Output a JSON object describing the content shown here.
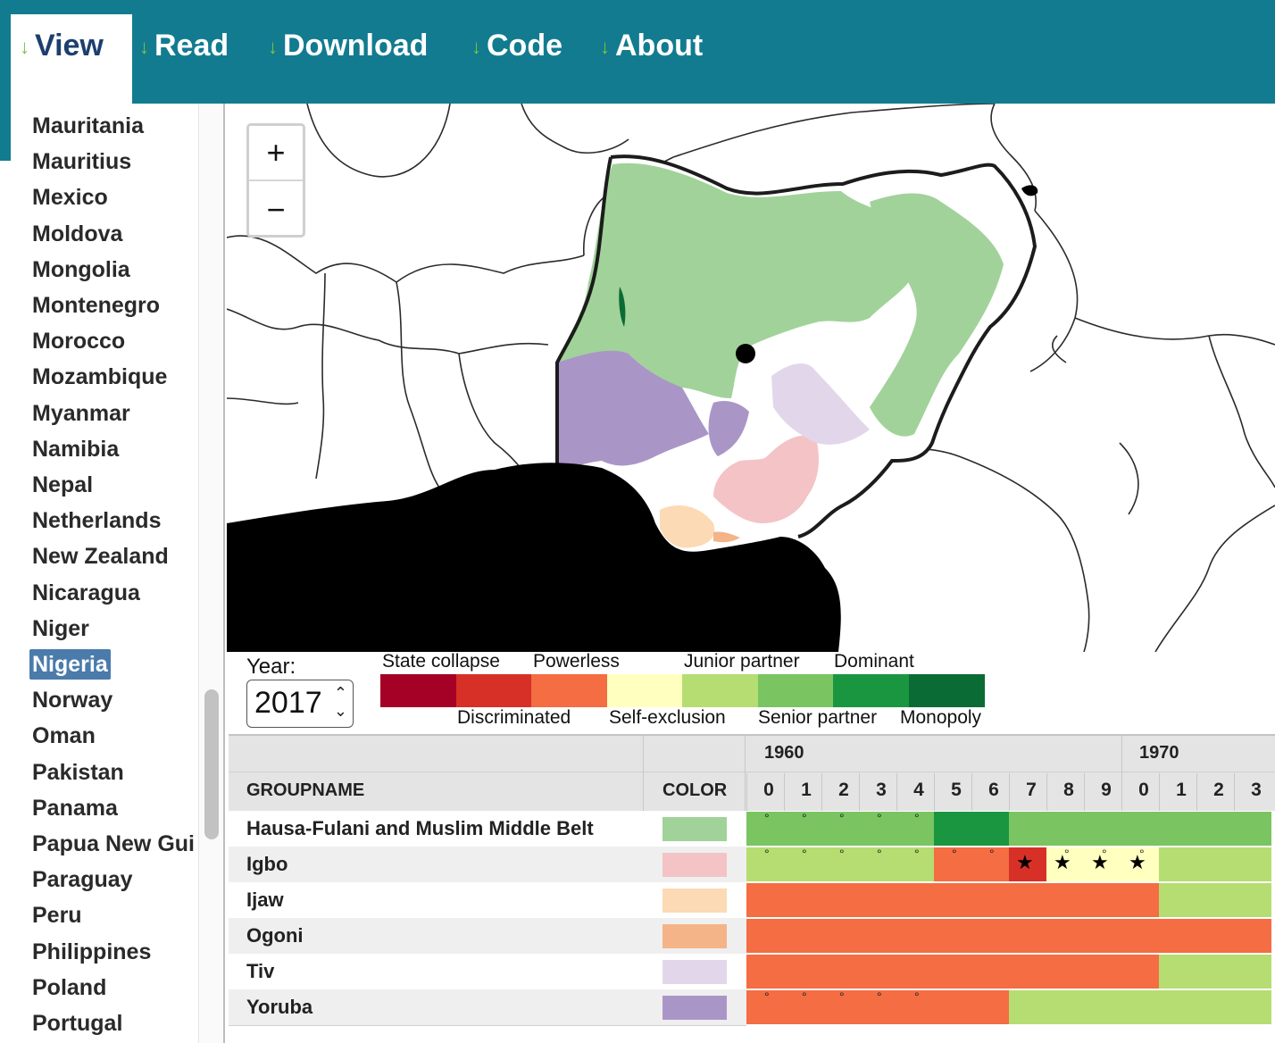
{
  "nav": {
    "tabs": [
      {
        "label": "View",
        "active": true
      },
      {
        "label": "Read",
        "active": false
      },
      {
        "label": "Download",
        "active": false
      },
      {
        "label": "Code",
        "active": false
      },
      {
        "label": "About",
        "active": false
      }
    ]
  },
  "sidebar": {
    "countries": [
      "Mauritania",
      "Mauritius",
      "Mexico",
      "Moldova",
      "Mongolia",
      "Montenegro",
      "Morocco",
      "Mozambique",
      "Myanmar",
      "Namibia",
      "Nepal",
      "Netherlands",
      "New Zealand",
      "Nicaragua",
      "Niger",
      "Nigeria",
      "Norway",
      "Oman",
      "Pakistan",
      "Panama",
      "Papua New Gui",
      "Paraguay",
      "Peru",
      "Philippines",
      "Poland",
      "Portugal"
    ],
    "selected": "Nigeria"
  },
  "map": {
    "zoom_in": "+",
    "zoom_out": "−"
  },
  "controls": {
    "year_label": "Year:",
    "year_value": "2017",
    "spin_glyph": "⌃⌄"
  },
  "legend": {
    "items": [
      {
        "label": "State collapse",
        "color": "#a50026"
      },
      {
        "label": "Discriminated",
        "color": "#d73027"
      },
      {
        "label": "Powerless",
        "color": "#f46d43"
      },
      {
        "label": "Self-exclusion",
        "color": "#ffffbf"
      },
      {
        "label": "Junior partner",
        "color": "#b5dd72"
      },
      {
        "label": "Senior partner",
        "color": "#7ac462"
      },
      {
        "label": "Dominant",
        "color": "#1a9641"
      },
      {
        "label": "Monopoly",
        "color": "#0b6b35"
      }
    ]
  },
  "table": {
    "col_groupname": "GROUPNAME",
    "col_color": "COLOR",
    "decades": [
      "1960",
      "1970"
    ],
    "year_digits": [
      "0",
      "1",
      "2",
      "3",
      "4",
      "5",
      "6",
      "7",
      "8",
      "9",
      "0",
      "1",
      "2",
      "3"
    ],
    "groups": [
      {
        "name": "Hausa-Fulani and Muslim Middle Belt",
        "swatch": "#a1d29a",
        "segments": [
          {
            "from": 0,
            "to": 5,
            "status": "Senior partner"
          },
          {
            "from": 5,
            "to": 7,
            "status": "Dominant"
          },
          {
            "from": 7,
            "to": 14,
            "status": "Senior partner"
          }
        ],
        "dots": [
          0,
          1,
          2,
          3,
          4
        ],
        "stars": []
      },
      {
        "name": "Igbo",
        "swatch": "#f4c3c6",
        "segments": [
          {
            "from": 0,
            "to": 5,
            "status": "Junior partner"
          },
          {
            "from": 5,
            "to": 7,
            "status": "Powerless"
          },
          {
            "from": 7,
            "to": 8,
            "status": "Discriminated"
          },
          {
            "from": 8,
            "to": 11,
            "status": "Self-exclusion"
          },
          {
            "from": 11,
            "to": 14,
            "status": "Junior partner"
          }
        ],
        "dots": [
          0,
          1,
          2,
          3,
          4,
          5,
          6,
          8,
          9,
          10
        ],
        "stars": [
          7,
          8,
          9,
          10
        ]
      },
      {
        "name": "Ijaw",
        "swatch": "#fcdab5",
        "segments": [
          {
            "from": 0,
            "to": 11,
            "status": "Powerless"
          },
          {
            "from": 11,
            "to": 14,
            "status": "Junior partner"
          }
        ],
        "dots": [],
        "stars": []
      },
      {
        "name": "Ogoni",
        "swatch": "#f4b488",
        "segments": [
          {
            "from": 0,
            "to": 14,
            "status": "Powerless"
          }
        ],
        "dots": [],
        "stars": []
      },
      {
        "name": "Tiv",
        "swatch": "#e2d7ea",
        "segments": [
          {
            "from": 0,
            "to": 11,
            "status": "Powerless"
          },
          {
            "from": 11,
            "to": 14,
            "status": "Junior partner"
          }
        ],
        "dots": [],
        "stars": []
      },
      {
        "name": "Yoruba",
        "swatch": "#aa96c6",
        "segments": [
          {
            "from": 0,
            "to": 7,
            "status": "Powerless"
          },
          {
            "from": 7,
            "to": 14,
            "status": "Junior partner"
          }
        ],
        "dots": [
          0,
          1,
          2,
          3,
          4
        ],
        "stars": []
      }
    ]
  }
}
